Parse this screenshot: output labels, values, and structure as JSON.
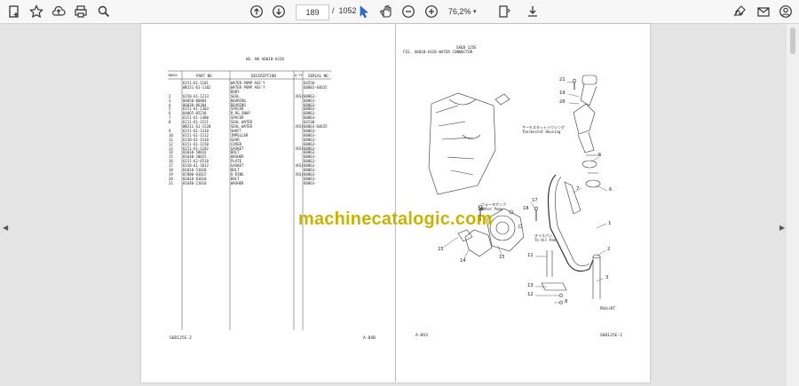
{
  "toolbar": {
    "current_page": "189",
    "page_separator": "/",
    "total_pages": "1052",
    "zoom": "76,2%",
    "icons": [
      "bookmark-add-icon",
      "star-icon",
      "upload-icon",
      "print-icon",
      "search-icon",
      "arrow-up-icon",
      "arrow-down-icon",
      "select-cursor-icon",
      "hand-icon",
      "zoom-out-icon",
      "zoom-in-icon",
      "fit-page-icon",
      "download-icon",
      "sign-icon",
      "mail-icon",
      "account-icon"
    ]
  },
  "left_page": {
    "group_no": "HG. NO   A6010-A3I8",
    "columns": [
      "INDEX",
      "PART NO",
      "DESCRIPTION",
      "Q'TY",
      "SERIAL NO"
    ],
    "rows": [
      [
        "",
        "6151-61-1101",
        "WATER PUMP ASS'Y",
        "",
        "64550-"
      ],
      [
        "",
        "WB151-61-1102",
        "WATER PUMP ASS'Y",
        "",
        "60883-64635"
      ],
      [
        "",
        "",
        "BODY",
        "",
        ""
      ],
      [
        "2",
        "6150-61-1213",
        "SEAL",
        "(KS)",
        "60863-"
      ],
      [
        "3",
        "06050-06004",
        "BEARING",
        "",
        "60863-"
      ],
      [
        "4",
        "06030-06304",
        "BEARING",
        "",
        "60863-"
      ],
      [
        "5",
        "6151-61-1303",
        "SPACER",
        "",
        "60863-"
      ],
      [
        "6",
        "04065-05230",
        "R.RG.SNAP",
        "",
        "60863-"
      ],
      [
        "7",
        "6151-61-1480",
        "SPACER",
        "",
        "60863-"
      ],
      [
        "8",
        "6211-61-1521",
        "SEAL WATER",
        "",
        "64530-"
      ],
      [
        "",
        "WB211-61-1520",
        "SEAL WATER",
        "(KS)",
        "60863-64635"
      ],
      [
        "9",
        "6151-61-1310",
        "SHAFT",
        "",
        "60863-"
      ],
      [
        "10",
        "6151-61-1212",
        "IMPELLER",
        "",
        "60863-"
      ],
      [
        "11",
        "6150-61-1410",
        "GEAR",
        "",
        "60863-"
      ],
      [
        "12",
        "6151-61-1150",
        "COVER",
        "",
        "60863-"
      ],
      [
        "13",
        "6151-61-1182",
        "GASKET",
        "(KS)",
        "60863-"
      ],
      [
        "14",
        "01010-50816",
        "BOLT",
        "",
        "60863-"
      ],
      [
        "15",
        "01640-20825",
        "WASHER",
        "",
        "60863-"
      ],
      [
        "16",
        "6151-62-6510",
        "PLATE",
        "",
        "60863-"
      ],
      [
        "17",
        "6150-61-1812",
        "GASKET",
        "(KS)",
        "60863-"
      ],
      [
        "18",
        "01010-51020",
        "BOLT",
        "",
        "60863-"
      ],
      [
        "19",
        "07000-01015",
        "O-RING",
        "(KS)",
        "60863-"
      ],
      [
        "20",
        "01010-81010",
        "BOLT",
        "",
        "60863-"
      ],
      [
        "21",
        "01640-21010",
        "WASHER",
        "",
        "60863-"
      ]
    ],
    "footer_left": "S6D125E-2",
    "footer_right": "A-84B"
  },
  "right_page": {
    "header_line1": "SA6D  125E",
    "header_line2": "FIG. A6010-A3I8   WATER CONNECTOR",
    "labels": {
      "thermostat_jp": "サーモスタットハウジング",
      "thermostat": "Thermostat Housing",
      "water_pump_jp": "ウォータポンプ",
      "water_pump": "Water Pump",
      "oil_pan_jp": "オイルパン",
      "oil_pan": "To Oil Pan"
    },
    "callouts": [
      "21",
      "19",
      "20",
      "6",
      "7",
      "6",
      "17",
      "16",
      "18",
      "1",
      "15",
      "14",
      "15",
      "2",
      "11",
      "3",
      "13",
      "12",
      "8"
    ],
    "figure_code": "P03ssRT",
    "footer_left": "A-093",
    "footer_right": "S6D125E-2"
  },
  "watermark": "machinecatalogic.com"
}
